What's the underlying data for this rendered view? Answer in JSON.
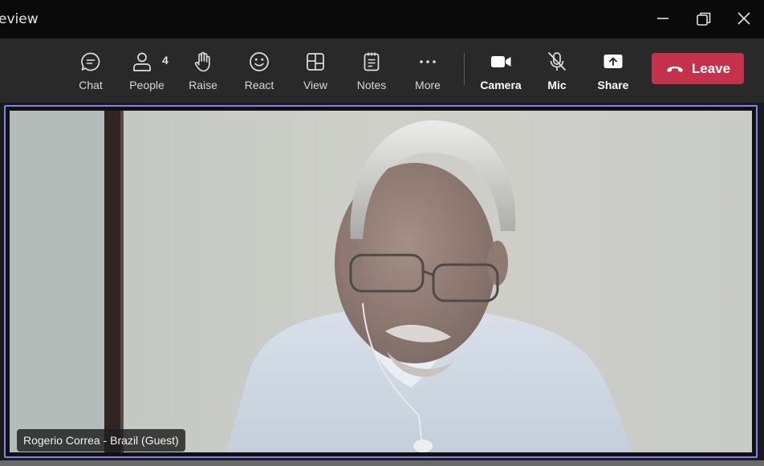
{
  "window": {
    "title": "eview",
    "buttons": [
      "minimize-icon",
      "restore-icon",
      "close-icon"
    ]
  },
  "toolbar": {
    "items": [
      {
        "label": "Chat",
        "icon": "chat-icon"
      },
      {
        "label": "People",
        "icon": "people-icon",
        "count": "4"
      },
      {
        "label": "Raise",
        "icon": "raise-hand-icon"
      },
      {
        "label": "React",
        "icon": "smiley-icon"
      },
      {
        "label": "View",
        "icon": "view-grid-icon"
      },
      {
        "label": "Notes",
        "icon": "notes-icon"
      },
      {
        "label": "More",
        "icon": "more-icon"
      }
    ],
    "media": [
      {
        "label": "Camera",
        "icon": "camera-icon"
      },
      {
        "label": "Mic",
        "icon": "mic-muted-icon"
      },
      {
        "label": "Share",
        "icon": "share-icon"
      }
    ],
    "leave_label": "Leave"
  },
  "video": {
    "participant_name": "Rogerio Correa - Brazil (Guest)",
    "active_speaker_color": "#7f85f5"
  },
  "colors": {
    "leave": "#c4314b",
    "toolbar_bg": "#292929",
    "titlebar_bg": "#0a0a0a"
  }
}
